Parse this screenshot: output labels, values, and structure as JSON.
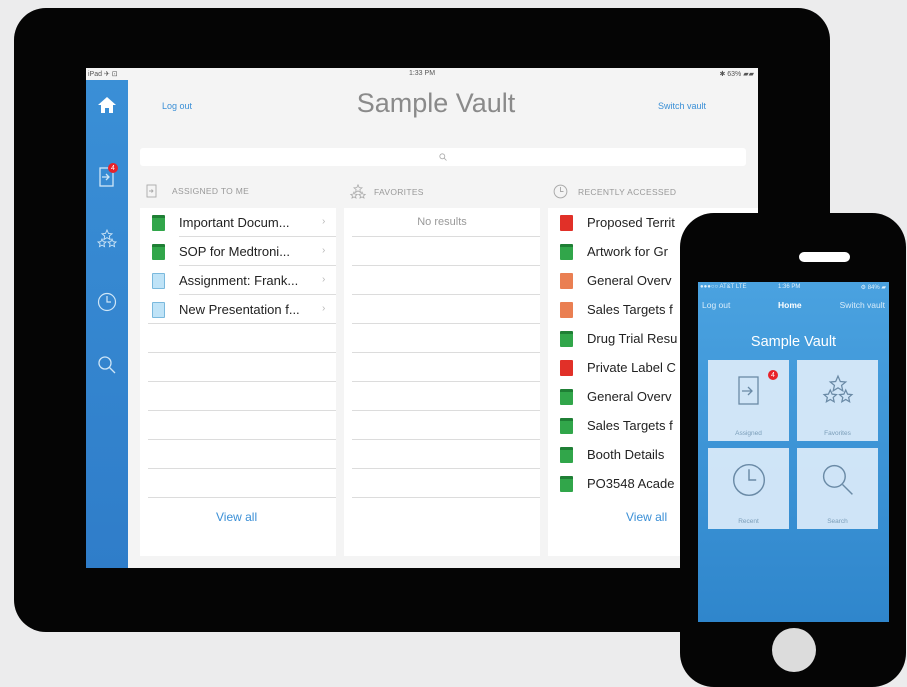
{
  "tablet": {
    "status": {
      "left": "iPad ✈ ⊡",
      "time": "1:33 PM",
      "right": "✱ 63% ▰▰"
    },
    "sidebar": {
      "assigned_badge": "4"
    },
    "header": {
      "logout": "Log out",
      "title": "Sample Vault",
      "switch": "Switch vault"
    },
    "columns": {
      "assigned": {
        "heading": "ASSIGNED TO ME",
        "items": [
          {
            "label": "Important Docum...",
            "icon": "green-doc-icon"
          },
          {
            "label": "SOP for Medtroni...",
            "icon": "green-doc-icon"
          },
          {
            "label": "Assignment: Frank...",
            "icon": "blue-doc-icon"
          },
          {
            "label": "New Presentation f...",
            "icon": "blue-doc-icon"
          }
        ],
        "view_all": "View all"
      },
      "favorites": {
        "heading": "FAVORITES",
        "empty": "No results"
      },
      "recent": {
        "heading": "RECENTLY ACCESSED",
        "items": [
          {
            "label": "Proposed Territ",
            "icon": "pdf-icon"
          },
          {
            "label": "Artwork for Gr",
            "icon": "green-doc-icon"
          },
          {
            "label": "General Overv",
            "icon": "orange-doc-icon"
          },
          {
            "label": "Sales Targets f",
            "icon": "orange-doc-icon"
          },
          {
            "label": "Drug Trial Resu",
            "icon": "green-doc-icon"
          },
          {
            "label": "Private Label C",
            "icon": "pdf-icon"
          },
          {
            "label": "General Overv",
            "icon": "green-doc-icon"
          },
          {
            "label": "Sales Targets f",
            "icon": "green-doc-icon"
          },
          {
            "label": "Booth Details",
            "icon": "green-doc-icon"
          },
          {
            "label": "PO3548 Acade",
            "icon": "green-doc-icon"
          }
        ],
        "view_all": "View all"
      }
    }
  },
  "phone": {
    "status": {
      "left": "●●●○○ AT&T LTE",
      "time": "1:36 PM",
      "right": "⚙ 84% ▰"
    },
    "nav": {
      "logout": "Log out",
      "home": "Home",
      "switch": "Switch vault"
    },
    "title": "Sample Vault",
    "tiles": [
      {
        "label": "Assigned",
        "icon": "assigned-icon",
        "badge": "4"
      },
      {
        "label": "Favorites",
        "icon": "favorites-icon"
      },
      {
        "label": "Recent",
        "icon": "clock-icon"
      },
      {
        "label": "Search",
        "icon": "search-icon"
      }
    ]
  },
  "colors": {
    "accent": "#3a8fd6",
    "badge": "#e8222a",
    "green_doc": "#31a64a",
    "pdf_red": "#e13028",
    "orange_doc": "#ea7f52"
  }
}
